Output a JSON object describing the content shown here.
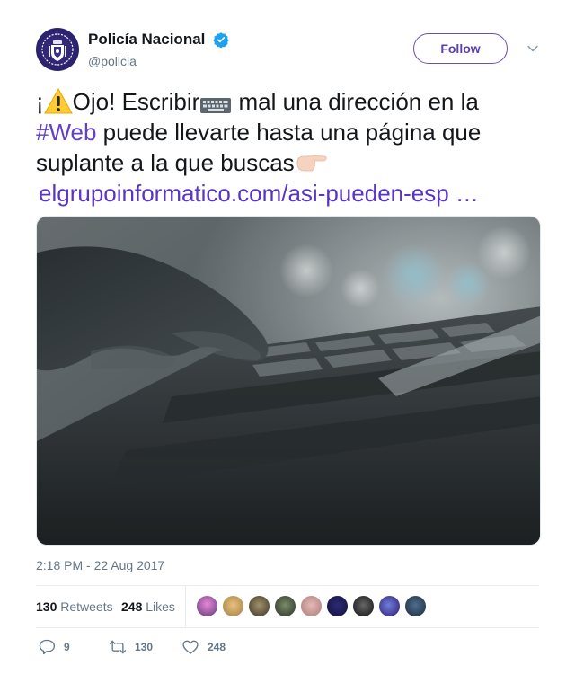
{
  "author": {
    "display_name": "Policía Nacional",
    "handle": "@policia",
    "verified_icon": "verified-badge-icon",
    "avatar_icon": "police-crest-icon"
  },
  "follow_button": {
    "label": "Follow"
  },
  "menu": {
    "icon": "chevron-down-icon"
  },
  "tweet": {
    "text_part1": "¡",
    "warning_emoji": "⚠️",
    "text_part2": "Ojo! Escribir",
    "keyboard_emoji": "⌨️",
    "text_part3": " mal una dirección en la ",
    "hashtag": "#Web",
    "text_part4": " puede llevarte hasta una página que suplante a la que buscas",
    "pointing_emoji": "👉🏻",
    "link": "elgrupoinformatico.com/asi-pueden-esp …"
  },
  "media": {
    "icon": "photo-hand-on-keyboard"
  },
  "timestamp": "2:18 PM - 22 Aug 2017",
  "stats": {
    "retweets_count": "130",
    "retweets_label": "Retweets",
    "likes_count": "248",
    "likes_label": "Likes"
  },
  "actions": {
    "reply_count": "9",
    "retweet_count": "130",
    "like_count": "248"
  },
  "colors": {
    "accent": "#6440c7",
    "follow_border": "#6a4fb5",
    "muted": "#657786",
    "verified": "#1da1f2"
  }
}
